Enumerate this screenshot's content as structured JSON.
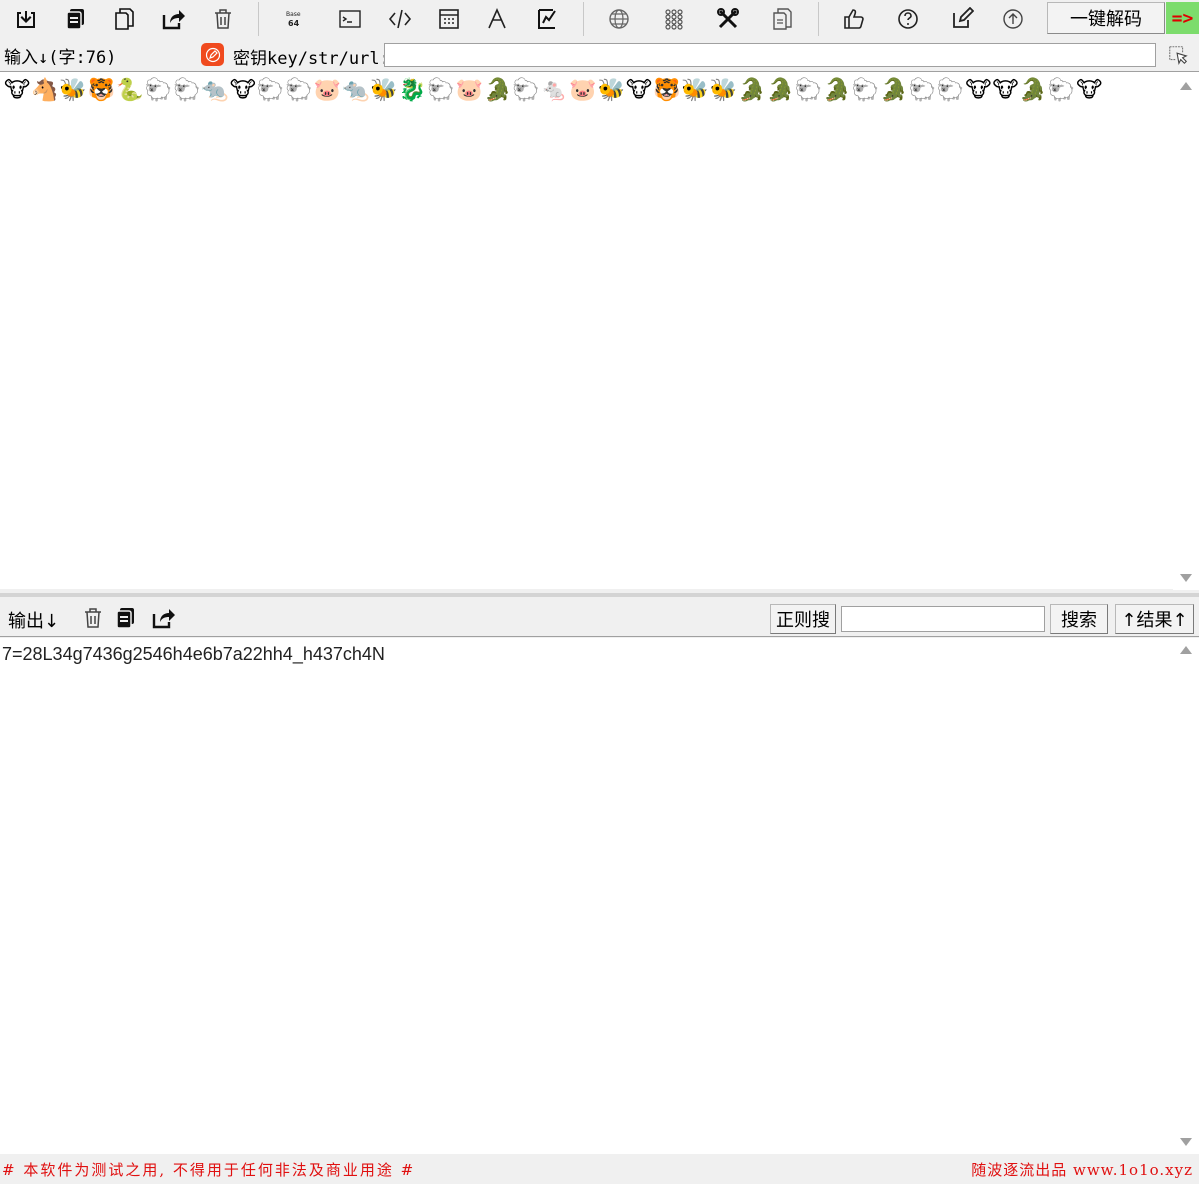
{
  "toolbar": {
    "icons": [
      "import-icon",
      "copy-icon",
      "paste-icon",
      "share-icon",
      "delete-icon",
      "base64-icon",
      "terminal-icon",
      "code-icon",
      "calculator-icon",
      "font-icon",
      "edit-chart-icon",
      "globe-icon",
      "grid-icon",
      "tools-icon",
      "document-icon",
      "thumbs-up-icon",
      "help-icon",
      "edit-icon",
      "upload-icon"
    ],
    "decode_label": "一键解码",
    "arrow_label": "=>"
  },
  "input": {
    "label": "输入↓(字:76)",
    "key_label": "密钥key/str/url:",
    "key_value": "",
    "content": "🐮🐴🐝🐯🐍🐑🐑🐀🐮🐑🐑🐷🐀🐝🐉🐑🐷🐊🐑🐁🐷🐝🐮🐯🐝🐝🐊🐊🐑🐊🐑🐊🐑🐑🐮🐮🐊🐑🐮"
  },
  "output": {
    "label": "输出↓",
    "regex_label": "正则搜",
    "search_value": "",
    "search_label": "搜索",
    "result_label": "↑结果↑",
    "content": "7=28L34g7436g2546h4e6b7a22hh4_h437ch4N"
  },
  "footer": {
    "left": "# 本软件为测试之用, 不得用于任何非法及商业用途 #",
    "right": "随波逐流出品 www.1o1o.xyz"
  },
  "colors": {
    "footer_text": "#e01010",
    "arrow_bg": "#7cdc6c",
    "arrow_fg": "#e00000",
    "key_icon_bg": "#f04a1e"
  }
}
